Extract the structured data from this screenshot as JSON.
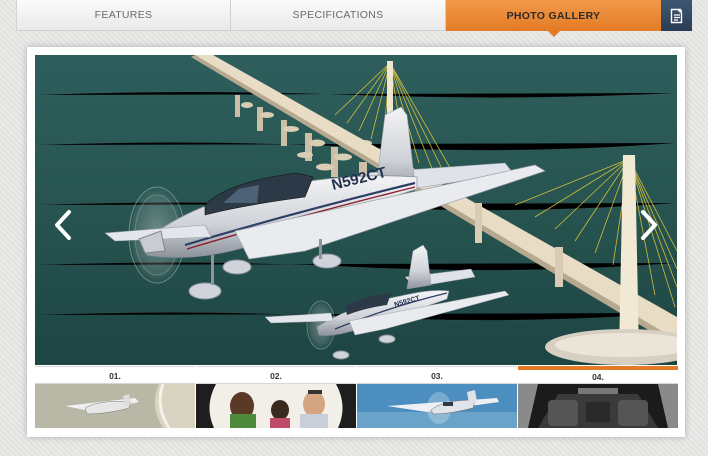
{
  "tabs": [
    {
      "label": "FEATURES",
      "active": false
    },
    {
      "label": "SPECIFICATIONS",
      "active": false
    },
    {
      "label": "PHOTO GALLERY",
      "active": true
    }
  ],
  "notes_icon": "add-note-icon",
  "accent_color": "#e37a25",
  "gallery": {
    "main_photo": {
      "tail_number_front": "N592CT",
      "tail_number_rear": "N592CT"
    },
    "prev_icon": "chevron-left-icon",
    "next_icon": "chevron-right-icon",
    "thumbnails": [
      {
        "label": "01.",
        "active": false
      },
      {
        "label": "02.",
        "active": false
      },
      {
        "label": "03.",
        "active": false
      },
      {
        "label": "04.",
        "active": true
      }
    ]
  }
}
